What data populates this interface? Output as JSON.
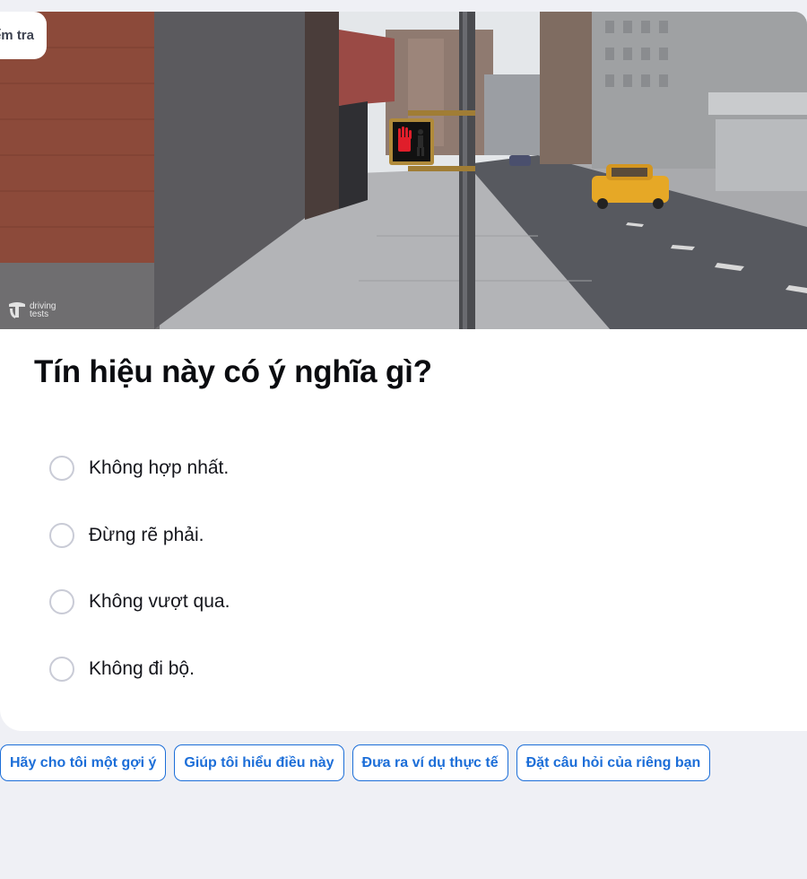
{
  "tag": {
    "label": "Kiểm tra"
  },
  "image": {
    "watermark_line1": "driving",
    "watermark_line2": "tests"
  },
  "question": {
    "text": "Tín hiệu này có ý nghĩa gì?"
  },
  "options": [
    {
      "label": "Không hợp nhất."
    },
    {
      "label": "Đừng rẽ phải."
    },
    {
      "label": "Không vượt qua."
    },
    {
      "label": "Không đi bộ."
    }
  ],
  "suggestions": [
    {
      "label": "Hãy cho tôi một gợi ý"
    },
    {
      "label": "Giúp tôi hiểu điều này"
    },
    {
      "label": "Đưa ra ví dụ thực tế"
    },
    {
      "label": "Đặt câu hỏi của riêng bạn"
    }
  ]
}
